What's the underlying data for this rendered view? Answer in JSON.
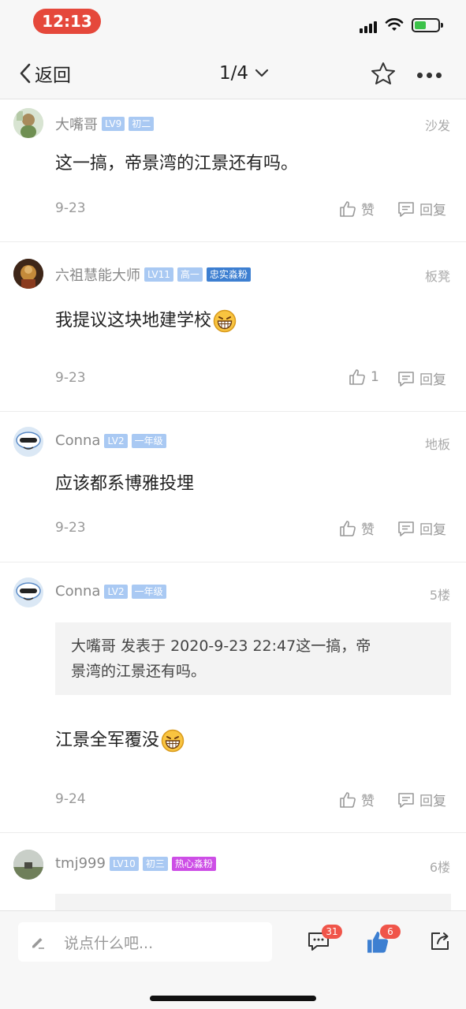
{
  "status": {
    "time": "12:13"
  },
  "nav": {
    "back_label": "返回",
    "page": "1/4"
  },
  "posts": [
    {
      "user": "大嘴哥",
      "level": "LV9",
      "grade": "初二",
      "floor": "沙发",
      "content": "这一搞，帝景湾的江景还有吗。",
      "date": "9-23",
      "like_label": "赞",
      "reply_label": "回复"
    },
    {
      "user": "六祖慧能大师",
      "level": "LV11",
      "grade": "高一",
      "fan": "忠实淼粉",
      "floor": "板凳",
      "content": "我提议这块地建学校",
      "date": "9-23",
      "like_label": "1",
      "reply_label": "回复"
    },
    {
      "user": "Conna",
      "level": "LV2",
      "grade": "一年级",
      "floor": "地板",
      "content": "应该都系博雅投埋",
      "date": "9-23",
      "like_label": "赞",
      "reply_label": "回复"
    },
    {
      "user": "Conna",
      "level": "LV2",
      "grade": "一年级",
      "floor": "5楼",
      "quote_line1": "大嘴哥 发表于 2020-9-23 22:47这一搞，帝",
      "quote_line2": "景湾的江景还有吗。",
      "content": "江景全军覆没",
      "date": "9-24",
      "like_label": "赞",
      "reply_label": "回复"
    },
    {
      "user": "tmj999",
      "level": "LV10",
      "grade": "初三",
      "fan": "热心淼粉",
      "floor": "6楼"
    }
  ],
  "bottom": {
    "placeholder": "说点什么吧...",
    "comment_count": "31",
    "like_count": "6"
  },
  "colors": {
    "accent_blue": "#3d7fd1",
    "badge_red": "#f0554a",
    "badge_light_blue": "#a9c9f3",
    "badge_purple": "#cd4ee6"
  }
}
